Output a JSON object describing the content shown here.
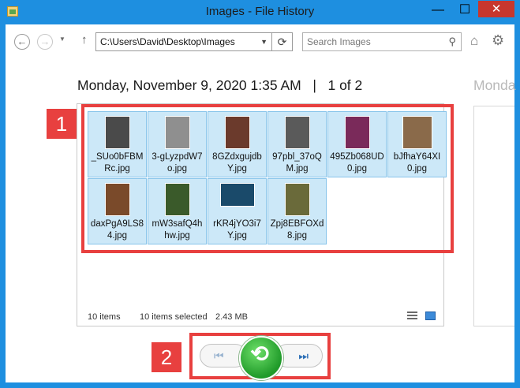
{
  "window": {
    "title": "Images - File History"
  },
  "controls": {
    "minimize": "—",
    "maximize": "☐",
    "close": "✕"
  },
  "nav": {
    "back_icon": "arrow-left-icon",
    "forward_icon": "arrow-right-icon",
    "address": "C:\\Users\\David\\Desktop\\Images",
    "search_placeholder": "Search Images"
  },
  "snapshot": {
    "date": "Monday, November 9, 2020 1:35 AM",
    "separator": "|",
    "position": "1 of 2",
    "next_date": "Monda"
  },
  "files": [
    {
      "name": "_SUo0bFBMRc.jpg",
      "thumb_color": "#4a4a4a",
      "thumb_w": 32,
      "thumb_h": 42
    },
    {
      "name": "3-gLyzpdW7o.jpg",
      "thumb_color": "#8f8f8f",
      "thumb_w": 32,
      "thumb_h": 42
    },
    {
      "name": "8GZdxgujdbY.jpg",
      "thumb_color": "#6b3a2c",
      "thumb_w": 32,
      "thumb_h": 42
    },
    {
      "name": "97pbl_37oQM.jpg",
      "thumb_color": "#5a5a5a",
      "thumb_w": 32,
      "thumb_h": 42
    },
    {
      "name": "495Zb068UD0.jpg",
      "thumb_color": "#7a2a5a",
      "thumb_w": 32,
      "thumb_h": 42
    },
    {
      "name": "bJfhaY64XI0.jpg",
      "thumb_color": "#8a6a4a",
      "thumb_w": 38,
      "thumb_h": 42
    },
    {
      "name": "daxPgA9LS84.jpg",
      "thumb_color": "#7a4a2a",
      "thumb_w": 32,
      "thumb_h": 42
    },
    {
      "name": "mW3safQ4hhw.jpg",
      "thumb_color": "#3a5a2a",
      "thumb_w": 32,
      "thumb_h": 42
    },
    {
      "name": "rKR4jYO3i7Y.jpg",
      "thumb_color": "#1a4a6a",
      "thumb_w": 44,
      "thumb_h": 30
    },
    {
      "name": "Zpj8EBFOXd8.jpg",
      "thumb_color": "#6a6a3a",
      "thumb_w": 32,
      "thumb_h": 42
    }
  ],
  "status": {
    "count": "10 items",
    "selected": "10 items selected",
    "size": "2.43 MB"
  },
  "callouts": {
    "one": "1",
    "two": "2"
  },
  "playback": {
    "previous_icon": "skip-previous-icon",
    "restore_icon": "restore-icon",
    "next_icon": "skip-next-icon"
  },
  "colors": {
    "titlebar": "#1e8fe0",
    "selection": "#cce8f8",
    "callout": "#e8403f",
    "restore": "#1f9a29"
  }
}
